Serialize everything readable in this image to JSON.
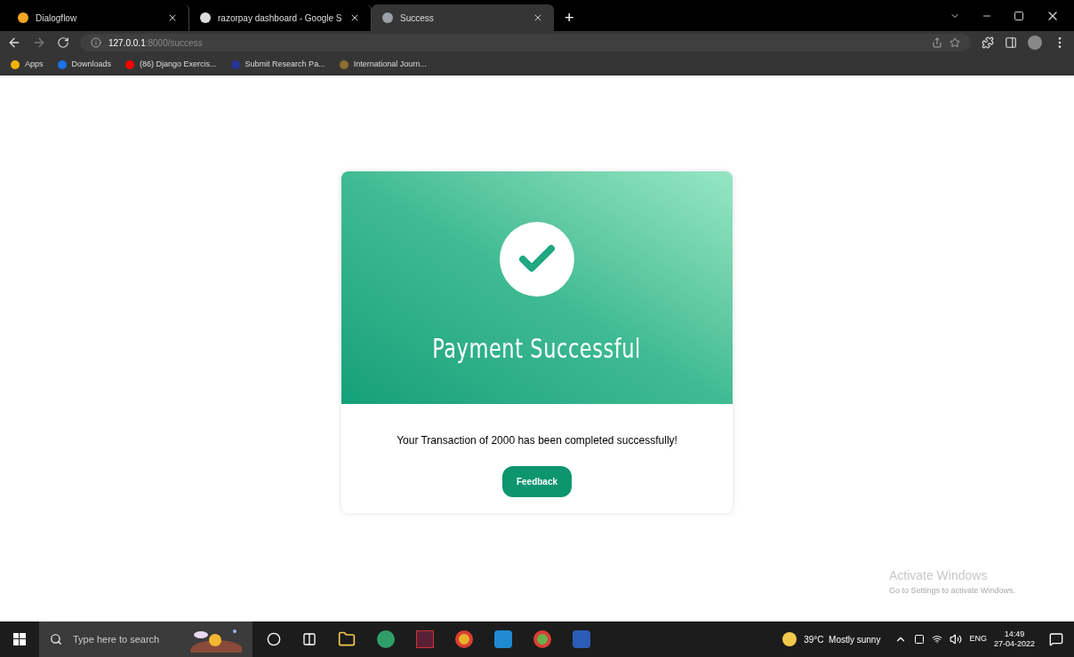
{
  "tabs": [
    {
      "title": "Dialogflow",
      "color": "#f5a623",
      "selected": false
    },
    {
      "title": "razorpay dashboard - Google S",
      "color": "#dddddd",
      "selected": false
    },
    {
      "title": "Success",
      "color": "#9aa0a6",
      "selected": true
    }
  ],
  "new_tab": "+",
  "address": {
    "host": "127.0.0.1",
    "path": ":8000/success"
  },
  "bookmarks": [
    {
      "label": "Apps",
      "color": "#f4b400"
    },
    {
      "label": "Downloads",
      "color": "#1a73e8"
    },
    {
      "label": "(86) Django Exercis...",
      "color": "#ff0000"
    },
    {
      "label": "Submit Research Pa...",
      "color": "#283593"
    },
    {
      "label": "International Journ...",
      "color": "#8d6e2f"
    }
  ],
  "card": {
    "title": "Payment Successful",
    "message": "Your Transaction of 2000 has been completed successfully!",
    "button": "Feedback"
  },
  "activation": {
    "title": "Activate Windows",
    "subtitle": "Go to Settings to activate Windows."
  },
  "taskbar": {
    "search_placeholder": "Type here to search",
    "weather": "39°C  Mostly sunny",
    "language": "ENG",
    "time": "14:49",
    "date": "27-04-2022"
  }
}
